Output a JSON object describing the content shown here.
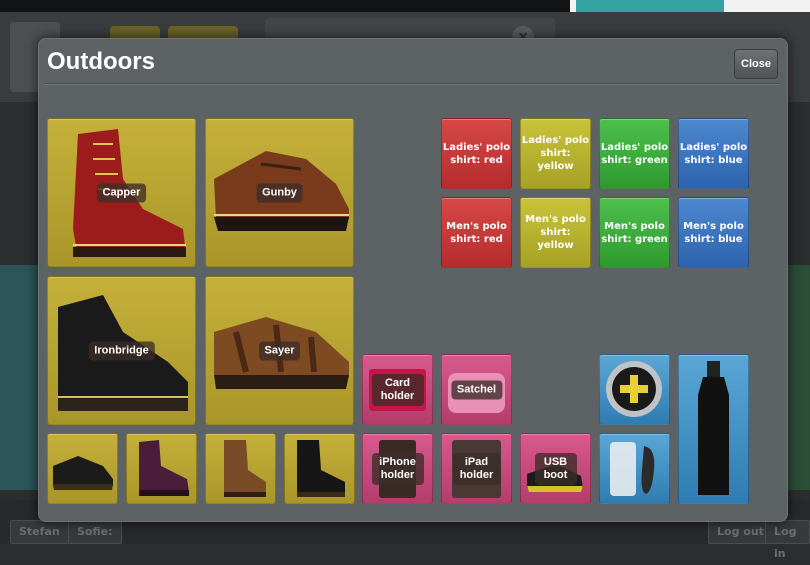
{
  "modal": {
    "title": "Outdoors",
    "close_label": "Close"
  },
  "boots_large": [
    {
      "label": "Capper"
    },
    {
      "label": "Gunby"
    },
    {
      "label": "Ironbridge"
    },
    {
      "label": "Sayer"
    }
  ],
  "polo_shirts": [
    {
      "label": "Ladies' polo shirt: red",
      "color": "#c83a3a"
    },
    {
      "label": "Ladies' polo shirt: yellow",
      "color": "#b8b230"
    },
    {
      "label": "Ladies' polo shirt: green",
      "color": "#3dae3d"
    },
    {
      "label": "Ladies' polo shirt: blue",
      "color": "#3d76bf"
    },
    {
      "label": "Men's polo shirt: red",
      "color": "#c83a3a"
    },
    {
      "label": "Men's polo shirt: yellow",
      "color": "#b8b230"
    },
    {
      "label": "Men's polo shirt: green",
      "color": "#3dae3d"
    },
    {
      "label": "Men's polo shirt: blue",
      "color": "#3d76bf"
    }
  ],
  "accessories": [
    {
      "label": "Card holder"
    },
    {
      "label": "Satchel"
    },
    {
      "label": "iPhone holder"
    },
    {
      "label": "iPad holder"
    },
    {
      "label": "USB boot"
    }
  ],
  "background": {
    "bottom_tabs": [
      "Stefan",
      "Sofie:",
      "Log out",
      "Log in"
    ]
  }
}
